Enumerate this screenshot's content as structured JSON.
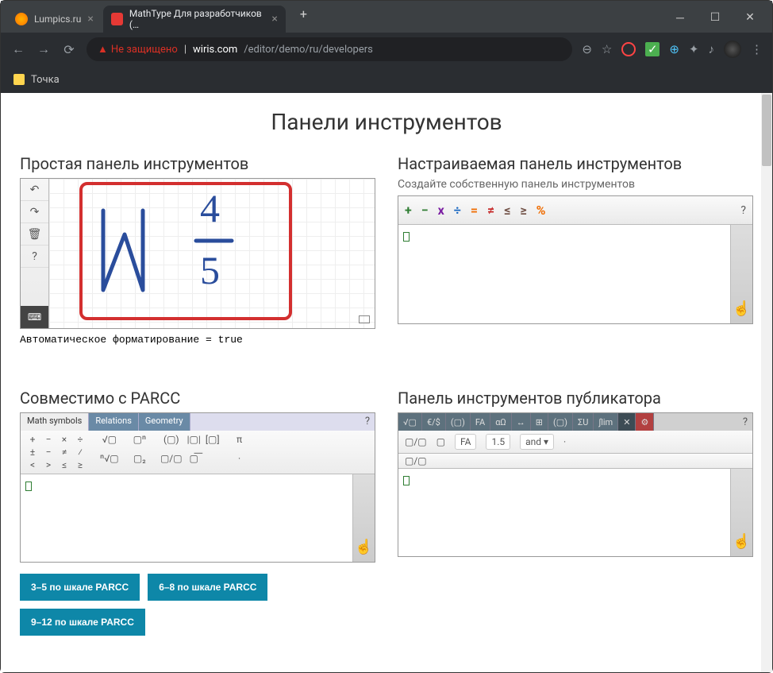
{
  "tabs": [
    {
      "label": "Lumpics.ru"
    },
    {
      "label": "MathType Для разработчиков (…"
    }
  ],
  "address": {
    "warn_label": "Не защищено",
    "url_host": "wiris.com",
    "url_path": "/editor/demo/ru/developers"
  },
  "bookmark": {
    "label": "Точка"
  },
  "page": {
    "title": "Панели инструментов"
  },
  "simple": {
    "heading": "Простая панель инструментов",
    "note": "Автоматическое форматирование = true",
    "frac_top": "4",
    "frac_bot": "5"
  },
  "custom": {
    "heading": "Настраиваемая панель инструментов",
    "sub": "Создайте собственную панель инструментов",
    "symbols": [
      {
        "c": "+",
        "color": "#2e7d32"
      },
      {
        "c": "−",
        "color": "#2e7d32"
      },
      {
        "c": "x",
        "color": "#7b1fa2"
      },
      {
        "c": "÷",
        "color": "#1565c0"
      },
      {
        "c": "=",
        "color": "#ef6c00"
      },
      {
        "c": "≠",
        "color": "#c62828"
      },
      {
        "c": "≤",
        "color": "#6d4c41"
      },
      {
        "c": "≥",
        "color": "#6d4c41"
      },
      {
        "c": "%",
        "color": "#ef6c00"
      }
    ]
  },
  "parcc": {
    "heading": "Совместимо с PARCC",
    "tabs": [
      "Math symbols",
      "Relations",
      "Geometry"
    ],
    "group1": [
      "+",
      "−",
      "×",
      "÷",
      "±",
      "−",
      "≠",
      "⁄",
      "<",
      ">",
      "≤",
      "≥"
    ],
    "group2": [
      "√▢",
      "ⁿ√▢",
      "▢ⁿ",
      "▢₂"
    ],
    "group3": [
      "(▢)",
      "|▢|",
      "▢/▢",
      "[▢]",
      "▢͞"
    ],
    "group4": [
      "π",
      "·"
    ],
    "buttons": [
      "3–5 по шкале PARCC",
      "6–8 по шкале PARCC",
      "9–12 по шкале PARCC"
    ]
  },
  "pub": {
    "heading": "Панель инструментов публикатора",
    "tabs": [
      "√▢",
      "€/$",
      "(▢)",
      "FA",
      "αΩ",
      "↔",
      "⊞",
      "(▢)",
      "ΣU",
      "∫lim",
      "✕",
      "⚙"
    ],
    "toolbar_items": [
      "▢/▢",
      "▢",
      "FA",
      "1.5",
      "and ▾",
      "·"
    ],
    "extra": "▢/▢"
  }
}
